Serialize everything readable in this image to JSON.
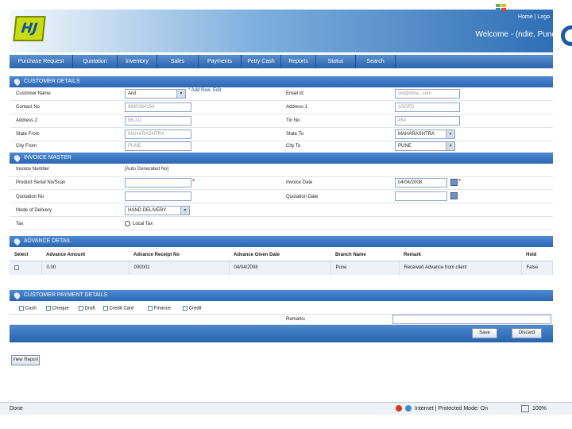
{
  "header": {
    "logo_text": "HJ",
    "top_links": "Home | Logo",
    "welcome": "Welcome - (ndie, Pune"
  },
  "nav": [
    "Purchase Request",
    "Quotation",
    "Inventory",
    "Sales",
    "Payments",
    "Petty Cash",
    "Reports",
    "Status",
    "Search"
  ],
  "customer": {
    "title": "CUSTOMER DETAILS",
    "customer_name_label": "Customer Name",
    "customer_name_value": "Anil",
    "add_new_link": "* Add New",
    "edit_link": "Edit",
    "email_label": "Email Id",
    "email_value": "std@dma...com",
    "contact_label": "Contact No",
    "contact_value": "9840394154",
    "address1_label": "Address 1",
    "address1_value": "ASDFD",
    "address2_label": "Address 2",
    "address2_value": "BKJJJ",
    "tin_label": "Tin No",
    "tin_value": "454",
    "state_from_label": "State From",
    "state_from_value": "MAHARASHTRA",
    "state_to_label": "State To",
    "state_to_value": "MAHARASHTRA",
    "city_from_label": "City From",
    "city_from_value": "PUNE",
    "city_to_label": "City To",
    "city_to_value": "PUNE"
  },
  "invoice": {
    "title": "INVOICE MASTER",
    "invoice_number_label": "Invoice Number",
    "invoice_number_value": "[Auto Generated No]",
    "serial_label": "Product Serial No/Scan",
    "invoice_date_label": "Invoice Date",
    "invoice_date_value": "04/04/2008",
    "quotation_label": "Quotation No",
    "quotation_date_label": "Quotation Date",
    "delivery_label": "Mode of Delivery",
    "delivery_value": "HAND DELIVERY",
    "tax_label": "Tax",
    "tax_option": "Local Tax"
  },
  "advance": {
    "title": "ADVANCE DETAIL",
    "columns": [
      "Select",
      "Advance Amount",
      "Advance Receipt No",
      "Advance Given Date",
      "Branch Name",
      "Remark",
      "Hold"
    ],
    "rows": [
      [
        "",
        "0.00",
        "000001",
        "04/04/2008",
        "Pune",
        "Received Advance from client",
        "False"
      ]
    ]
  },
  "payment": {
    "title": "CUSTOMER PAYMENT DETAILS",
    "options": [
      "Cash",
      "Cheque",
      "Draft",
      "Credit Card",
      "Finance",
      "Credit"
    ],
    "remarks_label": "Remarks"
  },
  "actions": {
    "save": "Save",
    "discard": "Discard",
    "view_report": "View Report"
  },
  "statusbar": {
    "left": "Done",
    "zone": "Internet | Protected Mode: On",
    "zoom": "100%"
  }
}
